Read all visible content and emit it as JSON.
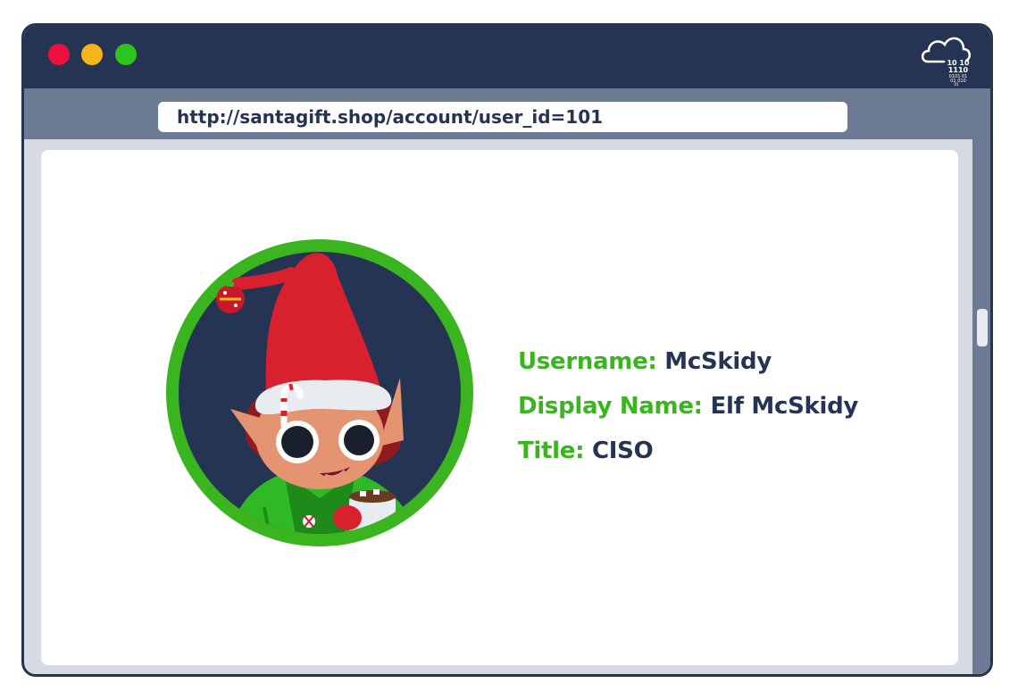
{
  "browser": {
    "url": "http://santagift.shop/account/user_id=101",
    "cloud_icon_text": [
      "10 10",
      "1110",
      "0101 01",
      "01  010",
      "01"
    ]
  },
  "profile": {
    "username_label": "Username:",
    "username": "McSkidy",
    "display_name_label": "Display Name:",
    "display_name": "Elf McSkidy",
    "title_label": "Title:",
    "title": "CISO"
  },
  "colors": {
    "frame": "#253453",
    "address_bar": "#6d7a93",
    "label_green": "#3ab51f",
    "value_navy": "#253453",
    "dot_red": "#ef0f3e",
    "dot_yellow": "#f3b517",
    "dot_green": "#2fc320"
  }
}
